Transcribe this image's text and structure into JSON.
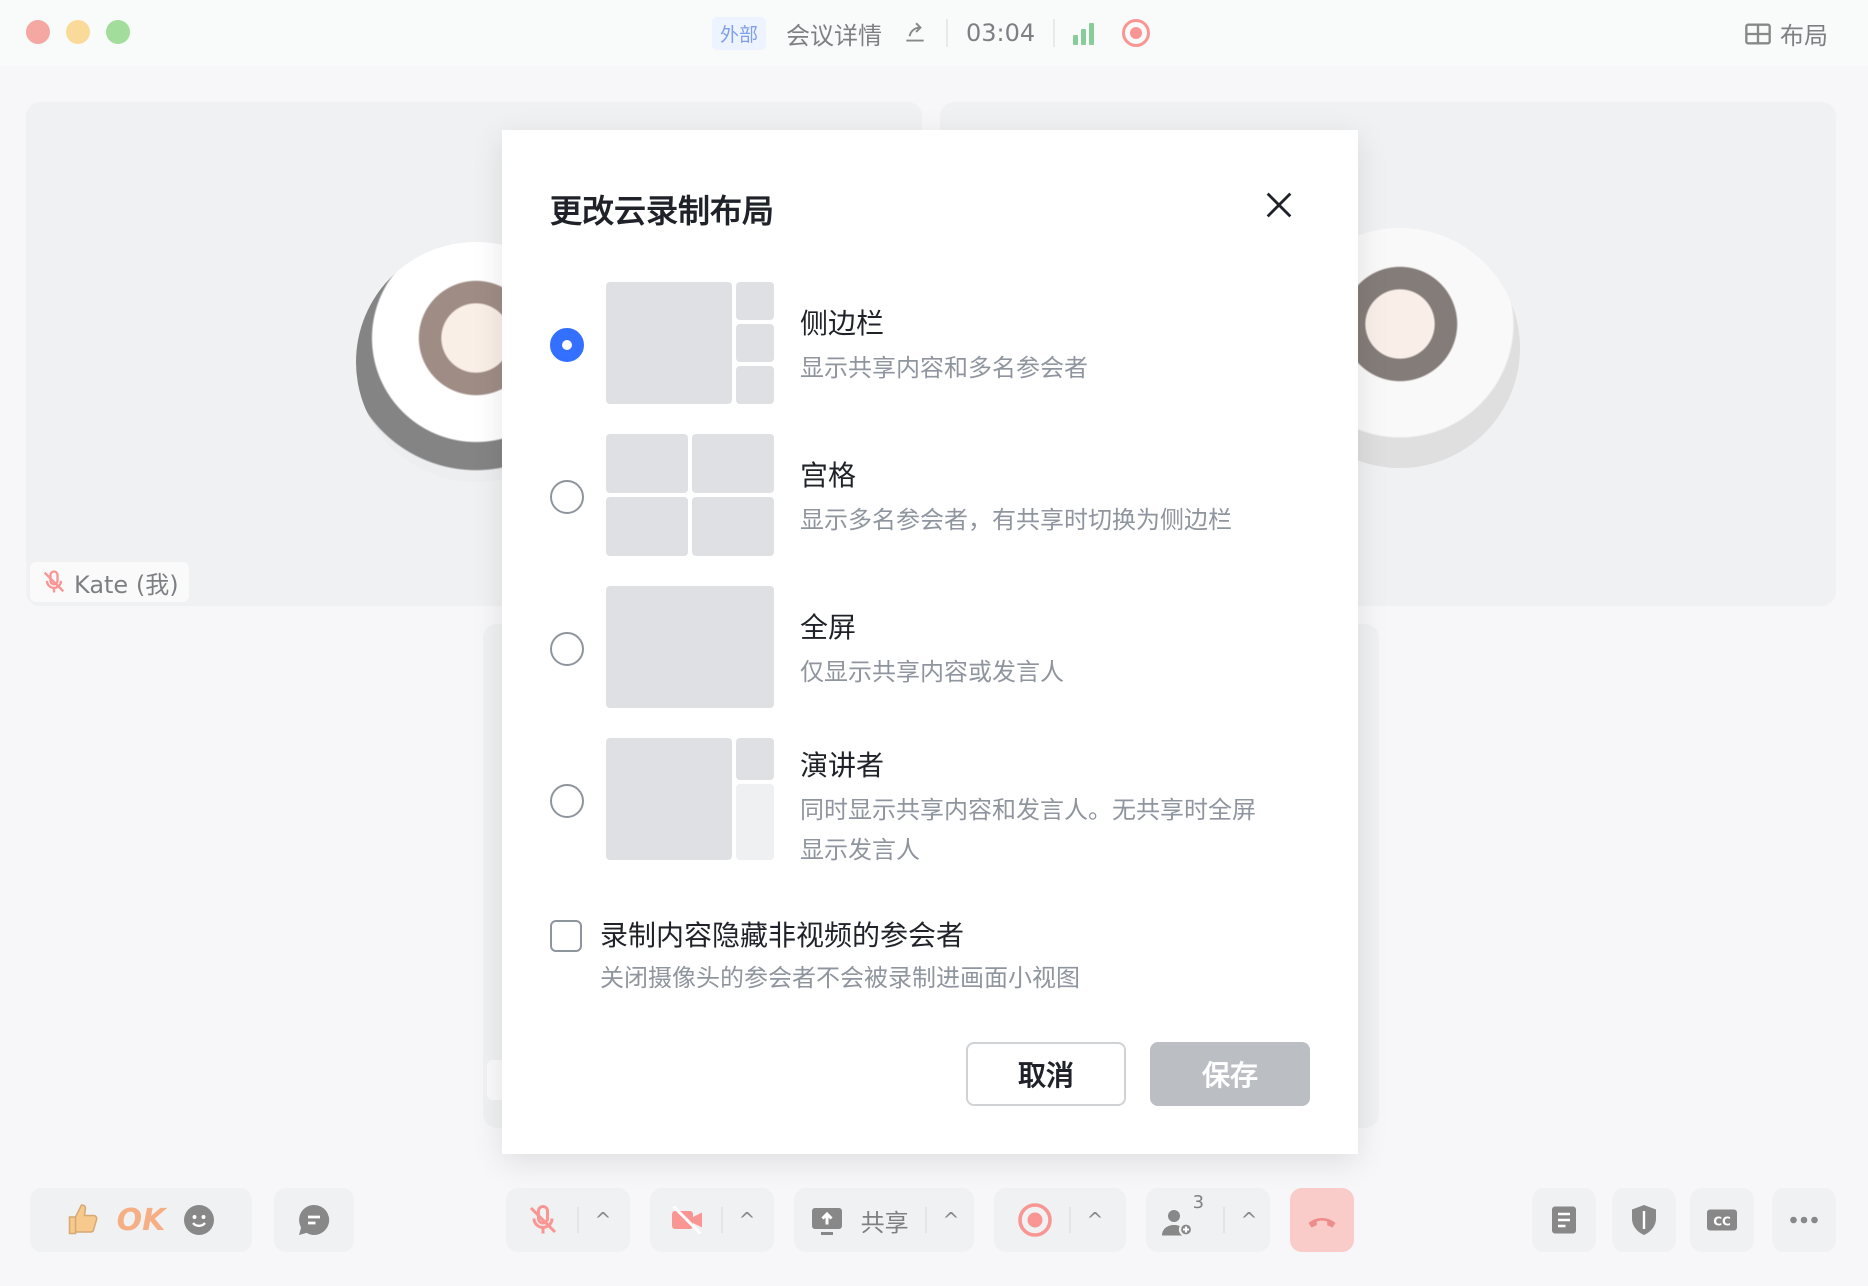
{
  "titlebar": {
    "tag": "外部",
    "meeting_details": "会议详情",
    "timer": "03:04",
    "layout_label": "布局"
  },
  "stage": {
    "self_name": "Kate (我)"
  },
  "toolbar": {
    "ok_reaction": "OK",
    "share_label": "共享",
    "participant_count": "3"
  },
  "dialog": {
    "title": "更改云录制布局",
    "options": [
      {
        "title": "侧边栏",
        "desc": "显示共享内容和多名参会者",
        "selected": true
      },
      {
        "title": "宫格",
        "desc": "显示多名参会者，有共享时切换为侧边栏",
        "selected": false
      },
      {
        "title": "全屏",
        "desc": "仅显示共享内容或发言人",
        "selected": false
      },
      {
        "title": "演讲者",
        "desc": "同时显示共享内容和发言人。无共享时全屏显示发言人",
        "selected": false
      }
    ],
    "hide_non_video": {
      "label": "录制内容隐藏非视频的参会者",
      "desc": "关闭摄像头的参会者不会被录制进画面小视图",
      "checked": false
    },
    "cancel_label": "取消",
    "save_label": "保存"
  },
  "colors": {
    "accent": "#3370ff",
    "external_tag_bg": "#e1eaff",
    "external_tag_text": "#245bdb",
    "record_red": "#f54a45",
    "save_disabled": "#bbbfc4"
  },
  "icons": [
    "share-icon",
    "signal-icon",
    "record-icon",
    "layout-icon",
    "close-icon",
    "mic-off-icon",
    "thumbs-up-icon",
    "smile-icon",
    "chat-icon",
    "camera-off-icon",
    "screen-share-icon",
    "participants-icon",
    "hangup-icon",
    "notes-icon",
    "shield-icon",
    "cc-icon",
    "more-icon"
  ]
}
